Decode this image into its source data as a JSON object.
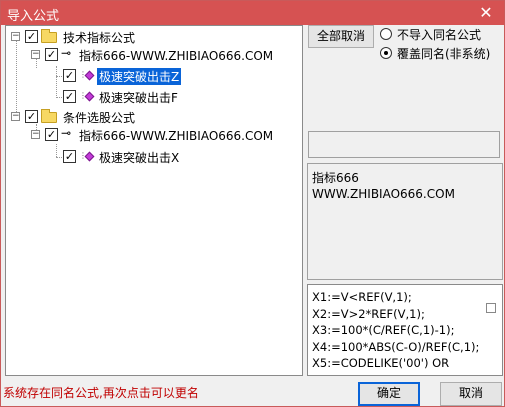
{
  "window": {
    "title": "导入公式",
    "close_glyph": "✕",
    "accent_color": "#d65252"
  },
  "tree": {
    "groups": [
      {
        "label": "技术指标公式",
        "checked": true,
        "expanded": true,
        "formula": {
          "label": "指标666-WWW.ZHIBIAO666.COM",
          "checked": true,
          "items": [
            {
              "label": "极速突破出击Z",
              "checked": true,
              "selected": true
            },
            {
              "label": "极速突破出击F",
              "checked": true,
              "selected": false
            }
          ]
        }
      },
      {
        "label": "条件选股公式",
        "checked": true,
        "expanded": true,
        "formula": {
          "label": "指标666-WWW.ZHIBIAO666.COM",
          "checked": true,
          "items": [
            {
              "label": "极速突破出击X",
              "checked": true,
              "selected": false
            }
          ]
        }
      }
    ],
    "check_glyph": "✓",
    "expander_glyph": "−"
  },
  "options": {
    "cancel_all_label": "全部取消",
    "radio_no_import": "不导入同名公式",
    "radio_overwrite": "覆盖同名(非系统)",
    "selected_radio": "overwrite"
  },
  "description": {
    "line1": "指标666",
    "line2": "WWW.ZHIBIAO666.COM"
  },
  "code": {
    "lines": [
      "X1:=V<REF(V,1);",
      "X2:=V>2*REF(V,1);",
      "X3:=100*(C/REF(C,1)-1);",
      "X4:=100*ABS(C-O)/REF(C,1);",
      "X5:=CODELIKE('00') OR"
    ]
  },
  "footer": {
    "status": "系统存在同名公式,再次点击可以更名",
    "status_color": "#c00000",
    "ok_label": "确定",
    "cancel_label": "取消"
  }
}
